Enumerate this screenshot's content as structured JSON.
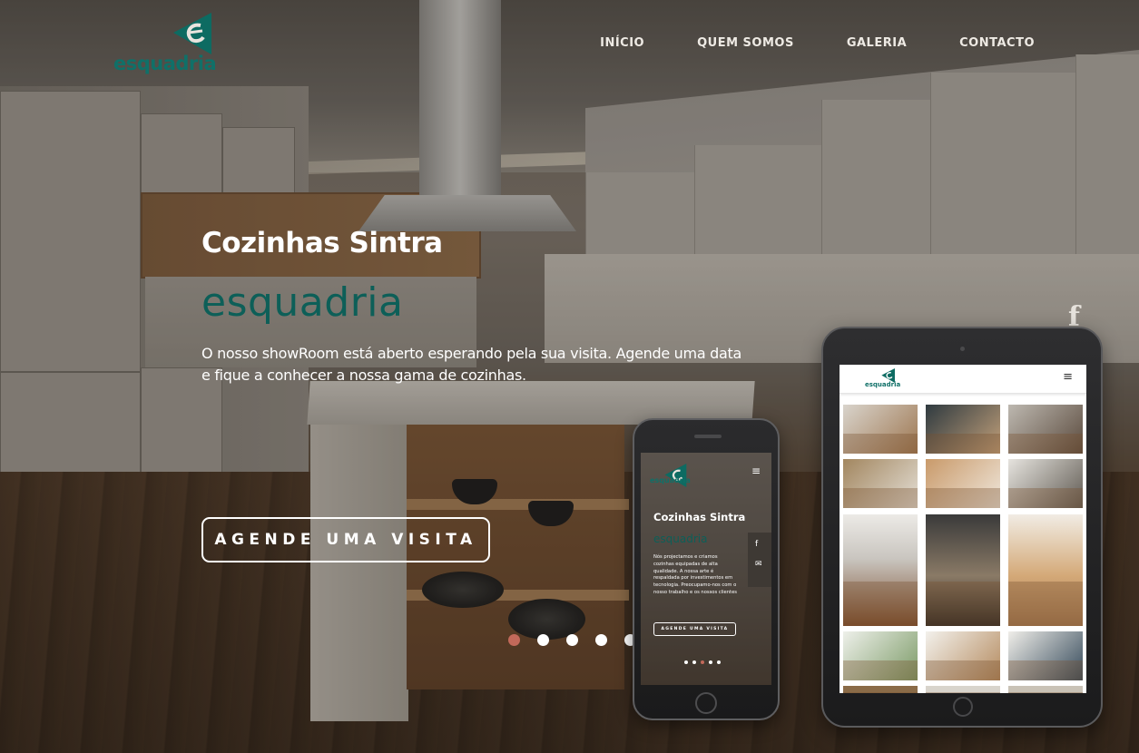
{
  "brand": {
    "logo_text": "esquadria"
  },
  "nav": {
    "items": [
      "INÍCIO",
      "QUEM SOMOS",
      "GALERIA",
      "CONTACTO"
    ]
  },
  "hero": {
    "title": "Cozinhas Sintra",
    "brand": "esquadria",
    "description": "O nosso showRoom está aberto esperando pela sua visita. Agende uma data e fique a conhecer a nossa gama de cozinhas.",
    "cta": "AGENDE UMA VISITA"
  },
  "slider": {
    "count": 5,
    "active": 1
  },
  "social": {
    "facebook": "f"
  },
  "phone": {
    "logo_text": "esquadria",
    "title": "Cozinhas Sintra",
    "brand": "esquadria",
    "description": "Nós projectamos e criamos cozinhas equipadas de alta qualidade. A nossa arte é respaldada por investimentos em tecnologia. Preocupamo-nos com o nosso trabalho e os nossos clientes",
    "cta": "AGENDE UMA VISITA",
    "side_icons": [
      "f",
      "✉"
    ],
    "menu_icon": "≡"
  },
  "tablet": {
    "logo_text": "esquadria",
    "menu_icon": "≡"
  },
  "colors": {
    "brand_teal": "#0d5f58",
    "active_dot": "#c2695a"
  },
  "icons": [
    "logo-mark-icon",
    "facebook-icon",
    "menu-icon",
    "mail-icon"
  ]
}
